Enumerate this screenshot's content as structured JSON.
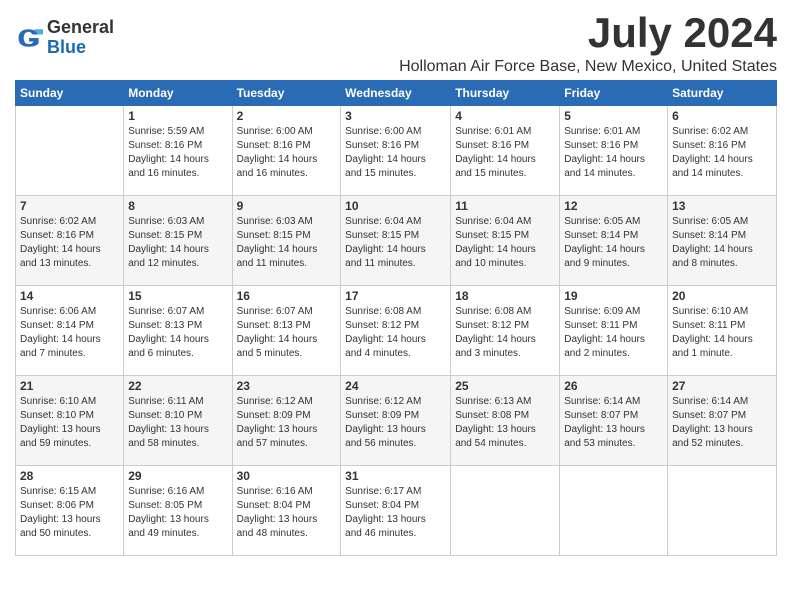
{
  "logo": {
    "general": "General",
    "blue": "Blue"
  },
  "title": "July 2024",
  "location": "Holloman Air Force Base, New Mexico, United States",
  "weekdays": [
    "Sunday",
    "Monday",
    "Tuesday",
    "Wednesday",
    "Thursday",
    "Friday",
    "Saturday"
  ],
  "weeks": [
    [
      {
        "day": "",
        "info": ""
      },
      {
        "day": "1",
        "info": "Sunrise: 5:59 AM\nSunset: 8:16 PM\nDaylight: 14 hours\nand 16 minutes."
      },
      {
        "day": "2",
        "info": "Sunrise: 6:00 AM\nSunset: 8:16 PM\nDaylight: 14 hours\nand 16 minutes."
      },
      {
        "day": "3",
        "info": "Sunrise: 6:00 AM\nSunset: 8:16 PM\nDaylight: 14 hours\nand 15 minutes."
      },
      {
        "day": "4",
        "info": "Sunrise: 6:01 AM\nSunset: 8:16 PM\nDaylight: 14 hours\nand 15 minutes."
      },
      {
        "day": "5",
        "info": "Sunrise: 6:01 AM\nSunset: 8:16 PM\nDaylight: 14 hours\nand 14 minutes."
      },
      {
        "day": "6",
        "info": "Sunrise: 6:02 AM\nSunset: 8:16 PM\nDaylight: 14 hours\nand 14 minutes."
      }
    ],
    [
      {
        "day": "7",
        "info": "Sunrise: 6:02 AM\nSunset: 8:16 PM\nDaylight: 14 hours\nand 13 minutes."
      },
      {
        "day": "8",
        "info": "Sunrise: 6:03 AM\nSunset: 8:15 PM\nDaylight: 14 hours\nand 12 minutes."
      },
      {
        "day": "9",
        "info": "Sunrise: 6:03 AM\nSunset: 8:15 PM\nDaylight: 14 hours\nand 11 minutes."
      },
      {
        "day": "10",
        "info": "Sunrise: 6:04 AM\nSunset: 8:15 PM\nDaylight: 14 hours\nand 11 minutes."
      },
      {
        "day": "11",
        "info": "Sunrise: 6:04 AM\nSunset: 8:15 PM\nDaylight: 14 hours\nand 10 minutes."
      },
      {
        "day": "12",
        "info": "Sunrise: 6:05 AM\nSunset: 8:14 PM\nDaylight: 14 hours\nand 9 minutes."
      },
      {
        "day": "13",
        "info": "Sunrise: 6:05 AM\nSunset: 8:14 PM\nDaylight: 14 hours\nand 8 minutes."
      }
    ],
    [
      {
        "day": "14",
        "info": "Sunrise: 6:06 AM\nSunset: 8:14 PM\nDaylight: 14 hours\nand 7 minutes."
      },
      {
        "day": "15",
        "info": "Sunrise: 6:07 AM\nSunset: 8:13 PM\nDaylight: 14 hours\nand 6 minutes."
      },
      {
        "day": "16",
        "info": "Sunrise: 6:07 AM\nSunset: 8:13 PM\nDaylight: 14 hours\nand 5 minutes."
      },
      {
        "day": "17",
        "info": "Sunrise: 6:08 AM\nSunset: 8:12 PM\nDaylight: 14 hours\nand 4 minutes."
      },
      {
        "day": "18",
        "info": "Sunrise: 6:08 AM\nSunset: 8:12 PM\nDaylight: 14 hours\nand 3 minutes."
      },
      {
        "day": "19",
        "info": "Sunrise: 6:09 AM\nSunset: 8:11 PM\nDaylight: 14 hours\nand 2 minutes."
      },
      {
        "day": "20",
        "info": "Sunrise: 6:10 AM\nSunset: 8:11 PM\nDaylight: 14 hours\nand 1 minute."
      }
    ],
    [
      {
        "day": "21",
        "info": "Sunrise: 6:10 AM\nSunset: 8:10 PM\nDaylight: 13 hours\nand 59 minutes."
      },
      {
        "day": "22",
        "info": "Sunrise: 6:11 AM\nSunset: 8:10 PM\nDaylight: 13 hours\nand 58 minutes."
      },
      {
        "day": "23",
        "info": "Sunrise: 6:12 AM\nSunset: 8:09 PM\nDaylight: 13 hours\nand 57 minutes."
      },
      {
        "day": "24",
        "info": "Sunrise: 6:12 AM\nSunset: 8:09 PM\nDaylight: 13 hours\nand 56 minutes."
      },
      {
        "day": "25",
        "info": "Sunrise: 6:13 AM\nSunset: 8:08 PM\nDaylight: 13 hours\nand 54 minutes."
      },
      {
        "day": "26",
        "info": "Sunrise: 6:14 AM\nSunset: 8:07 PM\nDaylight: 13 hours\nand 53 minutes."
      },
      {
        "day": "27",
        "info": "Sunrise: 6:14 AM\nSunset: 8:07 PM\nDaylight: 13 hours\nand 52 minutes."
      }
    ],
    [
      {
        "day": "28",
        "info": "Sunrise: 6:15 AM\nSunset: 8:06 PM\nDaylight: 13 hours\nand 50 minutes."
      },
      {
        "day": "29",
        "info": "Sunrise: 6:16 AM\nSunset: 8:05 PM\nDaylight: 13 hours\nand 49 minutes."
      },
      {
        "day": "30",
        "info": "Sunrise: 6:16 AM\nSunset: 8:04 PM\nDaylight: 13 hours\nand 48 minutes."
      },
      {
        "day": "31",
        "info": "Sunrise: 6:17 AM\nSunset: 8:04 PM\nDaylight: 13 hours\nand 46 minutes."
      },
      {
        "day": "",
        "info": ""
      },
      {
        "day": "",
        "info": ""
      },
      {
        "day": "",
        "info": ""
      }
    ]
  ]
}
